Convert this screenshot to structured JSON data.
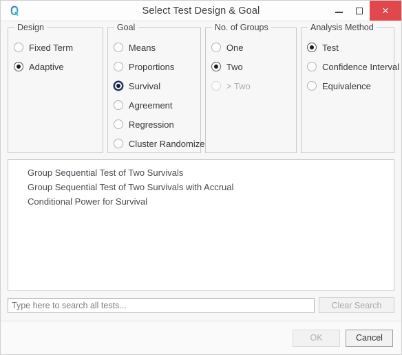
{
  "window": {
    "title": "Select Test Design & Goal",
    "app_icon": "q-logo-icon",
    "controls": {
      "minimize": "minimize-icon",
      "maximize": "maximize-icon",
      "close": "×"
    }
  },
  "groups": [
    {
      "key": "design",
      "title": "Design",
      "options": [
        {
          "label": "Fixed Term",
          "checked": false,
          "disabled": false,
          "focused": false
        },
        {
          "label": "Adaptive",
          "checked": true,
          "disabled": false,
          "focused": false
        }
      ]
    },
    {
      "key": "goal",
      "title": "Goal",
      "options": [
        {
          "label": "Means",
          "checked": false,
          "disabled": false,
          "focused": false
        },
        {
          "label": "Proportions",
          "checked": false,
          "disabled": false,
          "focused": false
        },
        {
          "label": "Survival",
          "checked": true,
          "disabled": false,
          "focused": true
        },
        {
          "label": "Agreement",
          "checked": false,
          "disabled": false,
          "focused": false
        },
        {
          "label": "Regression",
          "checked": false,
          "disabled": false,
          "focused": false
        },
        {
          "label": "Cluster Randomized",
          "checked": false,
          "disabled": false,
          "focused": false
        }
      ]
    },
    {
      "key": "groups",
      "title": "No. of Groups",
      "options": [
        {
          "label": "One",
          "checked": false,
          "disabled": false,
          "focused": false
        },
        {
          "label": "Two",
          "checked": true,
          "disabled": false,
          "focused": false
        },
        {
          "label": "> Two",
          "checked": false,
          "disabled": true,
          "focused": false
        }
      ]
    },
    {
      "key": "analysis",
      "title": "Analysis Method",
      "options": [
        {
          "label": "Test",
          "checked": true,
          "disabled": false,
          "focused": false
        },
        {
          "label": "Confidence Interval",
          "checked": false,
          "disabled": false,
          "focused": false
        },
        {
          "label": "Equivalence",
          "checked": false,
          "disabled": false,
          "focused": false
        }
      ]
    }
  ],
  "test_list": [
    "Group Sequential Test of Two Survivals",
    "Group Sequential Test of Two Survivals with Accrual",
    "Conditional Power for Survival"
  ],
  "search": {
    "value": "",
    "placeholder": "Type here to search all tests...",
    "clear_label": "Clear Search",
    "clear_disabled": true
  },
  "footer": {
    "ok_label": "OK",
    "ok_disabled": true,
    "cancel_label": "Cancel",
    "cancel_default": true
  },
  "colors": {
    "close_button": "#e0484b",
    "focus_ring": "#1f3864",
    "icon_blue": "#2d6fb8",
    "icon_teal": "#4ec3d6"
  }
}
